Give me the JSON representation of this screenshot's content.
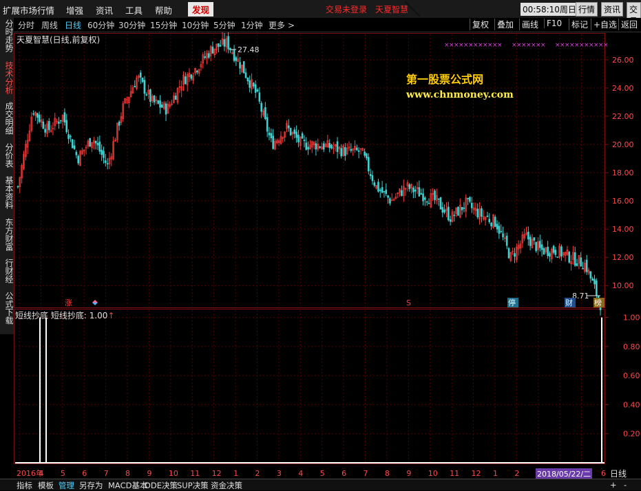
{
  "menu": {
    "items": [
      "扩展市场行情",
      "增强",
      "资讯",
      "工具",
      "帮助"
    ],
    "discover": "发现",
    "status_not_logged": "交易未登录",
    "app_name": "天夏智慧",
    "clock": "00:58:10",
    "weekday": "周日",
    "right_buttons": [
      "行情",
      "资讯",
      "交易"
    ]
  },
  "periods": {
    "items": [
      "分时",
      "周线",
      "日线",
      "60分钟",
      "30分钟",
      "15分钟",
      "10分钟",
      "5分钟",
      "1分钟",
      "更多 >"
    ],
    "active": "日线"
  },
  "toolbar": [
    "复权",
    "叠加",
    "画线",
    "F10",
    "标记",
    "+自选",
    "返回"
  ],
  "left_tabs": [
    "分时走势",
    "技术分析",
    "成交明细",
    "分价表",
    "基本资料",
    "东方财富",
    "行财经",
    "公式下载"
  ],
  "left_tabs_active": "技术分析",
  "chart_title": "天夏智慧(日线,前复权)",
  "watermark": {
    "line1": "第一股票公式网",
    "line2": "www.chnmoney.com"
  },
  "indicator": {
    "name": "短线抄底",
    "label": "短线抄底:",
    "value": "1.00",
    "arrow": "↑"
  },
  "markers": [
    "涨",
    "S",
    "停",
    "财",
    "榜"
  ],
  "date_info": "2018/05/22/二",
  "daily_button": "日线",
  "bottom_tabs": [
    "指标",
    "模板",
    "管理",
    "另存为",
    "MACD基本",
    "DDE决策",
    "SUP决策",
    "资金决策"
  ],
  "bottom_active": "管理",
  "colors": {
    "up": "#ff3b3b",
    "down": "#3fd3d3",
    "grid": "#5a0000",
    "frame": "#7a1010",
    "accent": "#4fd1ff"
  },
  "chart_data": [
    {
      "type": "candlestick",
      "title": "天夏智慧(日线,前复权)",
      "ylim": [
        8.5,
        27.8
      ],
      "y_ticks": [
        10.0,
        12.0,
        14.0,
        16.0,
        18.0,
        20.0,
        22.0,
        24.0,
        26.0
      ],
      "x_ticks": [
        "2016年",
        "4",
        "5",
        "6",
        "7",
        "8",
        "9",
        "10",
        "11",
        "12",
        "1",
        "2",
        "3",
        "4",
        "5",
        "6",
        "7",
        "8",
        "9",
        "10",
        "11",
        "12",
        "1",
        "2",
        "3",
        "4",
        "5",
        "6"
      ],
      "max_annotation": "27.48",
      "min_annotation": "8.71",
      "close_path": [
        [
          "2016年",
          17.0
        ],
        [
          "4",
          22.5
        ],
        [
          "4",
          21.0
        ],
        [
          "5",
          22.0
        ],
        [
          "5",
          19.0
        ],
        [
          "6",
          20.5
        ],
        [
          "6",
          18.5
        ],
        [
          "7",
          22.5
        ],
        [
          "7",
          24.8
        ],
        [
          "8",
          23.0
        ],
        [
          "8",
          22.5
        ],
        [
          "9",
          24.5
        ],
        [
          "9",
          25.5
        ],
        [
          "10",
          26.8
        ],
        [
          "10",
          27.2
        ],
        [
          "10",
          25.5
        ],
        [
          "11",
          23.5
        ],
        [
          "11",
          20.0
        ],
        [
          "12",
          21.2
        ],
        [
          "12",
          20.0
        ],
        [
          "1",
          20.0
        ],
        [
          "1",
          19.8
        ],
        [
          "2",
          19.5
        ],
        [
          "3",
          19.5
        ],
        [
          "4",
          17.0
        ],
        [
          "4",
          16.0
        ],
        [
          "5",
          17.0
        ],
        [
          "6",
          16.5
        ],
        [
          "7",
          16.0
        ],
        [
          "8",
          14.8
        ],
        [
          "9",
          15.8
        ],
        [
          "10",
          15.0
        ],
        [
          "11",
          14.5
        ],
        [
          "12",
          12.0
        ],
        [
          "1",
          13.5
        ],
        [
          "2",
          12.5
        ],
        [
          "3",
          12.5
        ],
        [
          "4",
          12.0
        ],
        [
          "5",
          11.5
        ],
        [
          "6",
          8.71
        ]
      ]
    },
    {
      "type": "line",
      "title": "短线抄底",
      "ylim": [
        0,
        1.05
      ],
      "y_ticks": [
        0.2,
        0.4,
        0.6,
        0.8,
        1.0
      ],
      "signals": [
        {
          "period": "2016年",
          "value": 1.0
        },
        {
          "period": "2016年",
          "value": 1.0
        },
        {
          "period": "6",
          "value": 1.0
        }
      ]
    }
  ]
}
